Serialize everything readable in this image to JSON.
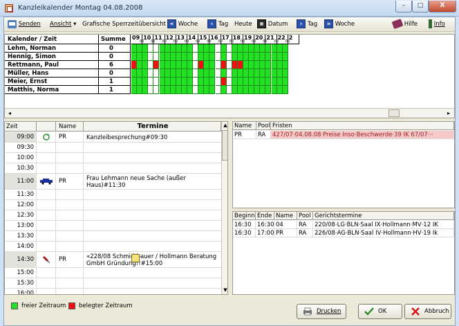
{
  "window": {
    "title": "Kanzleikalender Montag 04.08.2008",
    "min_glyph": "–",
    "max_glyph": "□",
    "close_glyph": "X"
  },
  "toolbar": {
    "send": "Senden",
    "view": "Ansicht",
    "view_arrow": "▾",
    "grafik": "Grafische Sperrzeitübersicht",
    "prev_week_glyph": "«",
    "week_label": "Woche",
    "prev_day_glyph": "‹",
    "day_label": "Tag",
    "today": "Heute",
    "cal_glyph": "▦",
    "date": "Datum",
    "next_day_glyph": "›",
    "next_day_label": "Tag",
    "next_week_glyph": "»",
    "next_week_label": "Woche",
    "help": "Hilfe",
    "info": "Info"
  },
  "grid": {
    "header_name": "Kalender / Zeit",
    "header_sum": "Summe",
    "hour_sub": "00",
    "hours": [
      "09",
      "10",
      "11",
      "12",
      "13",
      "14",
      "15",
      "16",
      "17",
      "18",
      "19",
      "20",
      "21",
      "22",
      "2"
    ],
    "rows": [
      {
        "name": "Lehm, Norman",
        "sum": "0",
        "busy": []
      },
      {
        "name": "Hennig, Simon",
        "sum": "0",
        "busy": []
      },
      {
        "name": "Rettmann, Paul",
        "sum": "6",
        "busy": [
          0,
          4,
          12,
          16,
          18,
          19
        ]
      },
      {
        "name": "Müller, Hans",
        "sum": "0",
        "busy": []
      },
      {
        "name": "Meier, Ernst",
        "sum": "1",
        "busy": [
          16
        ]
      },
      {
        "name": "Matthis, Norma",
        "sum": "1",
        "busy": []
      }
    ],
    "white_columns": [
      3,
      4,
      11,
      15,
      17
    ],
    "scroll_left": "◂",
    "scroll_right": "▸"
  },
  "appointments": {
    "col_time": "Zeit",
    "col_name": "Name",
    "col_termine": "Termine",
    "scroll_up": "▲",
    "scroll_down": "▼",
    "rows": [
      {
        "time": "09:00",
        "name": "PR",
        "text": "Kanzleibesprechung#09:30",
        "icon": "refresh"
      },
      {
        "time": "09:30",
        "name": "",
        "text": "",
        "icon": ""
      },
      {
        "time": "10:00",
        "name": "",
        "text": "",
        "icon": ""
      },
      {
        "time": "10:30",
        "name": "",
        "text": "",
        "icon": ""
      },
      {
        "time": "11:00",
        "name": "PR",
        "text": "Frau Lehmann neue Sache (außer Haus)#11:30",
        "icon": "car"
      },
      {
        "time": "11:30",
        "name": "",
        "text": "",
        "icon": ""
      },
      {
        "time": "12:00",
        "name": "",
        "text": "",
        "icon": ""
      },
      {
        "time": "12:30",
        "name": "",
        "text": "",
        "icon": ""
      },
      {
        "time": "13:00",
        "name": "",
        "text": "",
        "icon": ""
      },
      {
        "time": "13:30",
        "name": "",
        "text": "",
        "icon": ""
      },
      {
        "time": "14:00",
        "name": "",
        "text": "",
        "icon": ""
      },
      {
        "time": "14:30",
        "name": "PR",
        "text": "«228/08 Schmidtbauer / Hollmann Beratung GmbH Gründung!!#15:00",
        "icon": "pin"
      },
      {
        "time": "15:00",
        "name": "",
        "text": "",
        "icon": ""
      },
      {
        "time": "15:30",
        "name": "",
        "text": "",
        "icon": ""
      },
      {
        "time": "16:00",
        "name": "",
        "text": "",
        "icon": ""
      }
    ]
  },
  "fristen": {
    "headers": [
      "Name",
      "Pool",
      "Fristen"
    ],
    "rows": [
      {
        "name": "PR",
        "pool": "RA",
        "text": "427/07·04.08.08·Preise Inso·Beschwerde·39 IK 67/07···"
      }
    ]
  },
  "gericht": {
    "headers": [
      "Beginn",
      "Ende",
      "Name",
      "Pool",
      "Gerichtstermine"
    ],
    "rows": [
      {
        "begin": "16:30",
        "end": "16:30",
        "name": "04",
        "pool": "RA",
        "text": "220/08·LG·BLN·Saal IX·Hollmann·MV·12 IK"
      },
      {
        "begin": "16:30",
        "end": "17:00",
        "name": "PR",
        "pool": "RA",
        "text": "226/08·AG·BLN·Saal IV·Hollmann·HV·19 Ik"
      }
    ]
  },
  "legend": {
    "free": "freier Zeitraum",
    "busy": "belegter Zeitraum"
  },
  "buttons": {
    "print": "Drucken",
    "ok": "OK",
    "cancel": "Abbruch"
  },
  "colors": {
    "free": "#22e022",
    "busy": "#ee1111"
  }
}
